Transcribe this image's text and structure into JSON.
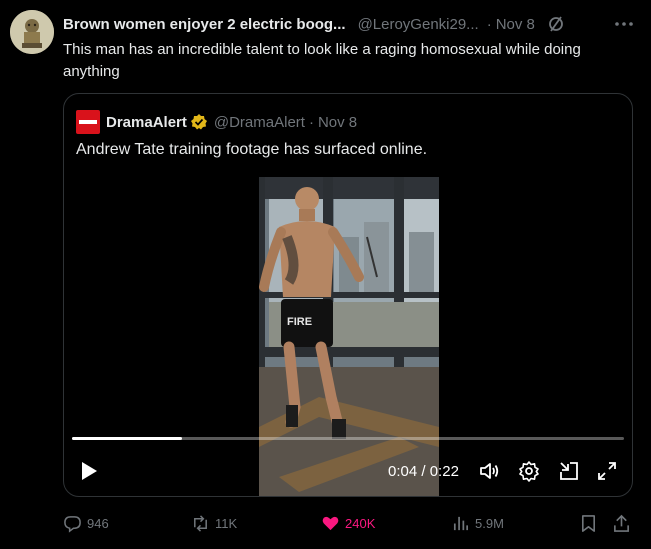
{
  "tweet": {
    "author_name": "Brown women enjoyer 2 electric boog...",
    "author_handle": "@LeroyGenki29...",
    "separator": "·",
    "date": "Nov 8",
    "text": "This man has an incredible talent to look like a raging homosexual while doing anything"
  },
  "quote": {
    "author_name": "DramaAlert",
    "author_handle": "@DramaAlert",
    "separator": "·",
    "date": "Nov 8",
    "text": "Andrew Tate training footage has surfaced online.",
    "video": {
      "current_time": "0:04",
      "time_separator": "/",
      "duration": "0:22",
      "progress_fraction": 0.2,
      "overlay_text": "FIRE"
    }
  },
  "actions": {
    "replies": "946",
    "reposts": "11K",
    "likes": "240K",
    "views": "5.9M"
  },
  "colors": {
    "background": "#000000",
    "text": "#e7e9ea",
    "muted": "#71767b",
    "border": "#2f3336",
    "like": "#f91880",
    "verified": "#e2b719"
  },
  "icons": {
    "grok": "grok-icon",
    "more": "more-icon",
    "verified": "verified-badge-icon",
    "play": "play-icon",
    "volume": "volume-icon",
    "settings": "settings-icon",
    "pip": "picture-in-picture-icon",
    "fullscreen": "fullscreen-icon",
    "reply": "reply-icon",
    "repost": "repost-icon",
    "like": "heart-icon",
    "views": "views-icon",
    "bookmark": "bookmark-icon",
    "share": "share-icon"
  }
}
